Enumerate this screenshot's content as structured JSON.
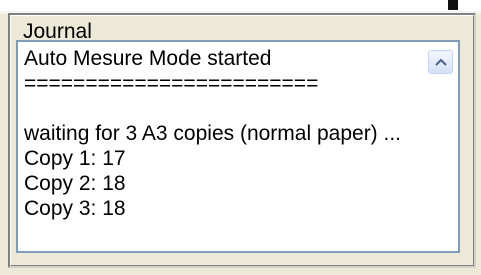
{
  "journal": {
    "title": "Journal",
    "log_lines": [
      "Auto Mesure Mode started",
      "========================",
      "",
      "waiting for 3 A3 copies (normal paper) ...",
      "Copy 1: 17",
      "Copy 2: 18",
      "Copy 3: 18"
    ],
    "scroll_up_icon": "scroll-up-arrow-icon"
  },
  "colors": {
    "window_bg": "#ece9d8",
    "textbox_border": "#7f9db9",
    "scroll_button": "#d7e2f7"
  }
}
